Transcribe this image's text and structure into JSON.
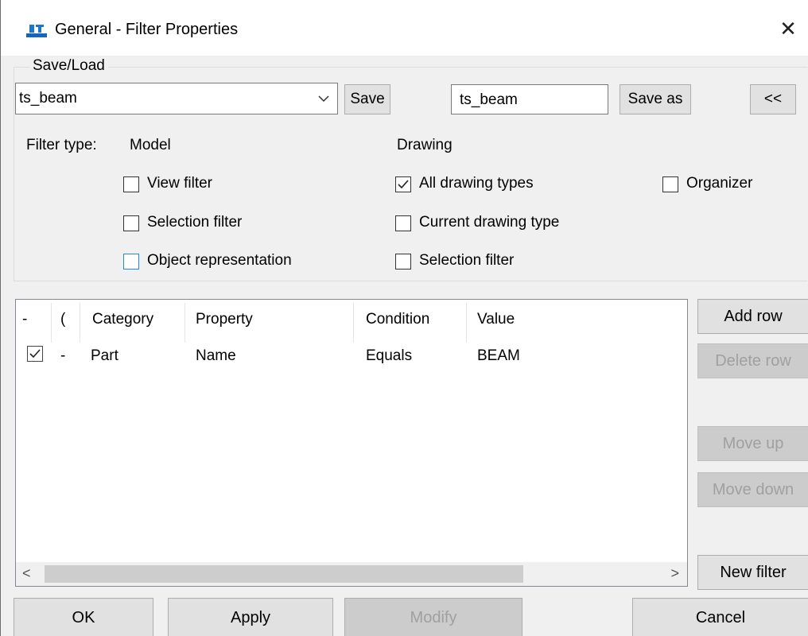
{
  "window": {
    "title": "General - Filter Properties",
    "close_glyph": "✕"
  },
  "save_load": {
    "group_label": "Save/Load",
    "combo_value": "ts_beam",
    "save_label": "Save",
    "save_as_value": "ts_beam",
    "save_as_label": "Save as",
    "collapse_label": "<<"
  },
  "filter_type": {
    "label": "Filter type:",
    "model_heading": "Model",
    "drawing_heading": "Drawing",
    "model_options": [
      {
        "label": "View filter",
        "checked": false
      },
      {
        "label": "Selection filter",
        "checked": false
      },
      {
        "label": "Object representation",
        "checked": false
      }
    ],
    "drawing_options": [
      {
        "label": "All drawing types",
        "checked": true
      },
      {
        "label": "Current drawing type",
        "checked": false
      },
      {
        "label": "Selection filter",
        "checked": false
      }
    ],
    "organizer": {
      "label": "Organizer",
      "checked": false
    }
  },
  "grid": {
    "headers": [
      "-",
      "(",
      "Category",
      "Property",
      "Condition",
      "Value"
    ],
    "rows": [
      {
        "checked": true,
        "paren": "-",
        "category": "Part",
        "property": "Name",
        "condition": "Equals",
        "value": "BEAM"
      }
    ],
    "scroll_left": "<",
    "scroll_right": ">"
  },
  "side_buttons": {
    "add_row": "Add row",
    "delete_row": "Delete row",
    "move_up": "Move up",
    "move_down": "Move down",
    "new_filter": "New filter"
  },
  "footer": {
    "ok": "OK",
    "apply": "Apply",
    "modify": "Modify",
    "cancel": "Cancel"
  }
}
